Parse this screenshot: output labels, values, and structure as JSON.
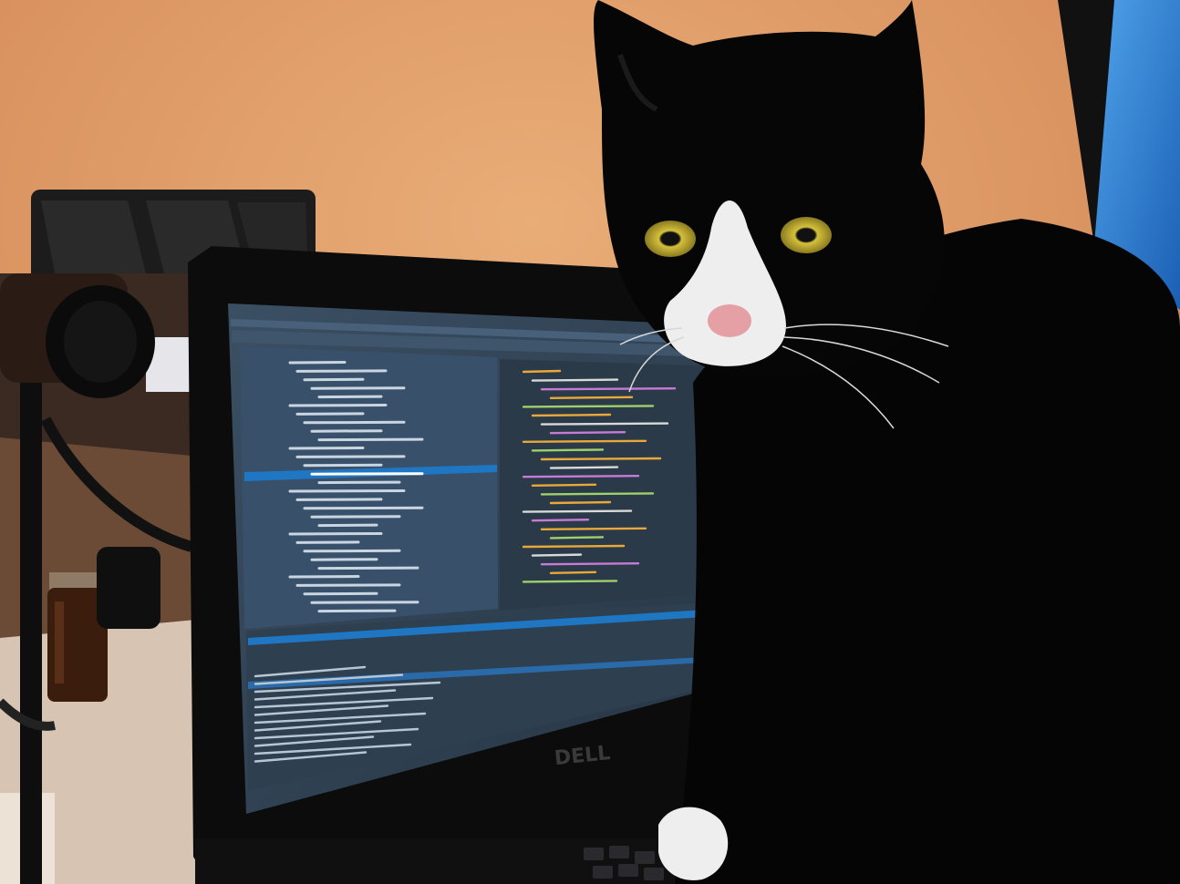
{
  "scene": {
    "subject": "cat",
    "laptop_brand": "DELL",
    "colors": {
      "wall": "#e3a06b",
      "wall_shadow": "#b8784e",
      "ide_background": "#2e3d4d",
      "ide_panel": "#36485a",
      "ide_selection": "#1f77c4",
      "cat_fur": "#050505",
      "cat_white": "#eeeeee",
      "cat_eye": "#b8a12a",
      "monitor_glow": "#2d7fd6"
    },
    "icons": [
      "dell-logo-icon",
      "lamp-icon",
      "jar-icon"
    ]
  }
}
